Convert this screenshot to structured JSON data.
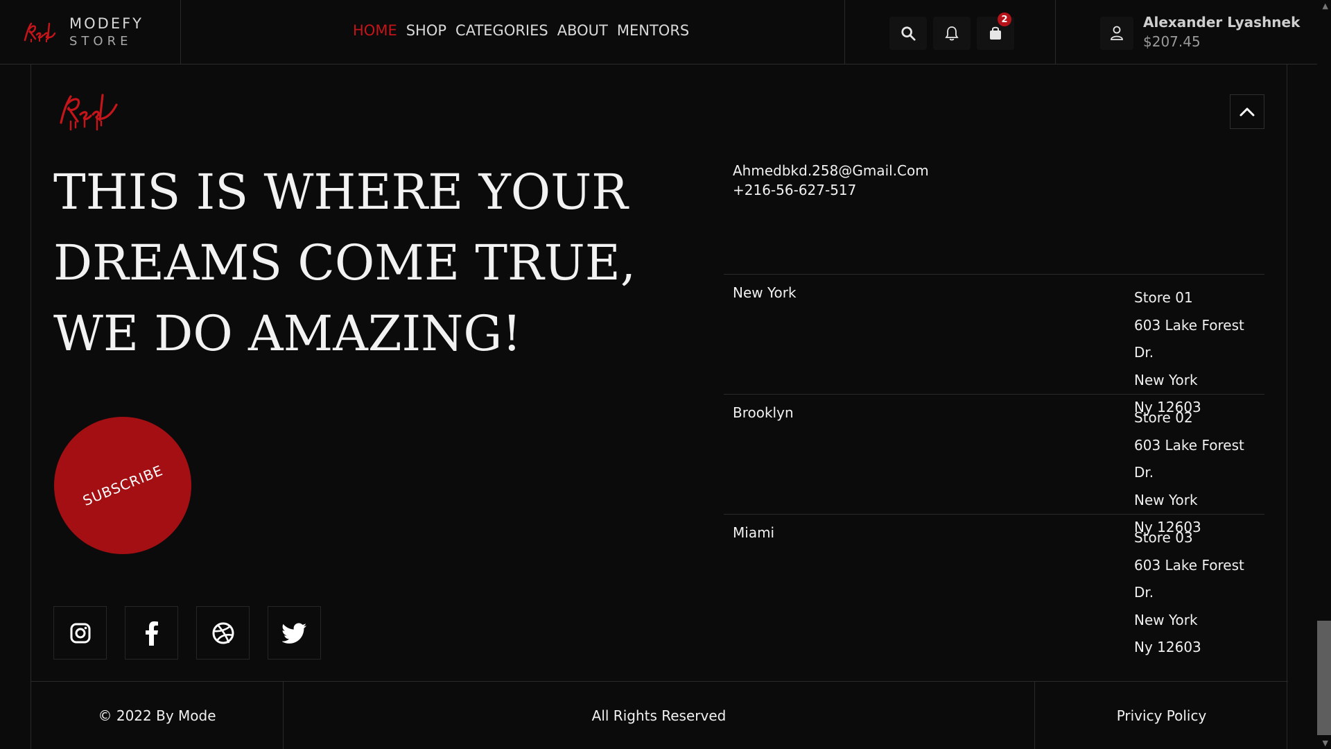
{
  "brand": {
    "name": "MODEFY",
    "sub": "STORE"
  },
  "nav": [
    {
      "label": "HOME",
      "active": true
    },
    {
      "label": "SHOP"
    },
    {
      "label": "CATEGORIES"
    },
    {
      "label": "ABOUT"
    },
    {
      "label": "MENTORS"
    }
  ],
  "header_icons": {
    "search": "search-icon",
    "notifications": "bell-icon",
    "cart": "bag-icon",
    "cart_count": "2"
  },
  "user": {
    "name": "Alexander Lyashnek",
    "balance": "$207.45",
    "icon": "user-icon"
  },
  "footer": {
    "headline": [
      "THIS IS WHERE YOUR",
      "DREAMS COME TRUE,",
      "WE DO AMAZING!"
    ],
    "subscribe_label": "SUBSCRIBE",
    "email": "Ahmedbkd.258@Gmail.Com",
    "phone": "+216-56-627-517",
    "stores": [
      {
        "city": "New York",
        "lines": [
          "Store 01",
          "603 Lake Forest Dr.",
          "New York",
          "Ny 12603"
        ]
      },
      {
        "city": "Brooklyn",
        "lines": [
          "Store 02",
          "603 Lake Forest Dr.",
          "New York",
          "Ny 12603"
        ]
      },
      {
        "city": "Miami",
        "lines": [
          "Store 03",
          "603 Lake Forest Dr.",
          "New York",
          "Ny 12603"
        ]
      }
    ],
    "socials": [
      "instagram-icon",
      "facebook-icon",
      "dribbble-icon",
      "twitter-icon"
    ],
    "copyright": "© 2022 By Mode",
    "rights": "All Rights Reserved",
    "privacy": "Privicy Policy"
  },
  "colors": {
    "accent": "#c3151a",
    "subscribe": "#a30f12",
    "background": "#0b0b0b"
  }
}
